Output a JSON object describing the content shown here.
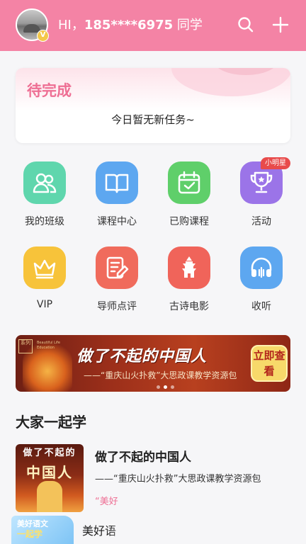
{
  "header": {
    "greeting": "HI，",
    "phone": "185****6975",
    "suffix": " 同学",
    "vip_badge": "V",
    "icons": [
      "search-icon",
      "plus-icon"
    ],
    "bg_color": "#f483a5"
  },
  "pending": {
    "title": "待完成",
    "message": "今日暂无新任务~"
  },
  "grid": [
    {
      "label": "我的班级",
      "icon": "class-icon",
      "color": "#5fd6ad"
    },
    {
      "label": "课程中心",
      "icon": "book-icon",
      "color": "#5da7f0"
    },
    {
      "label": "已购课程",
      "icon": "calendar-check-icon",
      "color": "#5fcf6a"
    },
    {
      "label": "活动",
      "icon": "trophy-icon",
      "color": "#9b74e8",
      "badge": "小明星"
    },
    {
      "label": "VIP",
      "icon": "crown-icon",
      "color": "#f7c33a"
    },
    {
      "label": "导师点评",
      "icon": "edit-note-icon",
      "color": "#f06b5c"
    },
    {
      "label": "古诗电影",
      "icon": "pagoda-icon",
      "color": "#f0645a"
    },
    {
      "label": "收听",
      "icon": "headphones-icon",
      "color": "#5da7f0"
    }
  ],
  "banner": {
    "title": "做了不起的中国人",
    "subtitle": "——“重庆山火扑救”大思政课教学资源包",
    "button": "立即查看",
    "tag": "系列",
    "tag2": "Beautiful Life Education"
  },
  "section": {
    "title": "大家一起学"
  },
  "course": {
    "thumb_top": "做了不起的",
    "thumb_main": "中国人",
    "title": "做了不起的中国人",
    "subtitle": "——“重庆山火扑救”大思政课教学资源包",
    "tag": "“美好"
  },
  "floatbar": {
    "badge_line1": "美好语文",
    "badge_line2": "一起学",
    "text": "美好语"
  }
}
